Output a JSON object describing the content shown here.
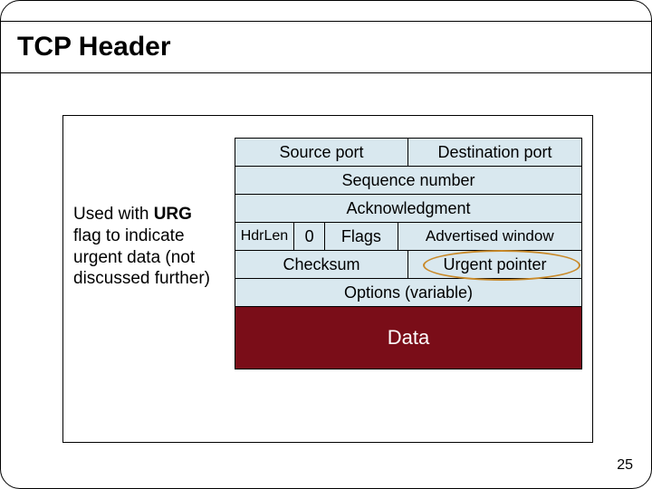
{
  "title": "TCP Header",
  "annotation": "Used with URG flag to indicate urgent data (not discussed further)",
  "header": {
    "row1": {
      "source_port": "Source port",
      "dest_port": "Destination port"
    },
    "row2": {
      "sequence": "Sequence number"
    },
    "row3": {
      "ack": "Acknowledgment"
    },
    "row4": {
      "hdrlen": "HdrLen",
      "zero": "0",
      "flags": "Flags",
      "adv_window": "Advertised window"
    },
    "row5": {
      "checksum": "Checksum",
      "urgent": "Urgent pointer"
    },
    "row6": {
      "options": "Options (variable)"
    },
    "row7": {
      "data": "Data"
    }
  },
  "page_number": "25"
}
